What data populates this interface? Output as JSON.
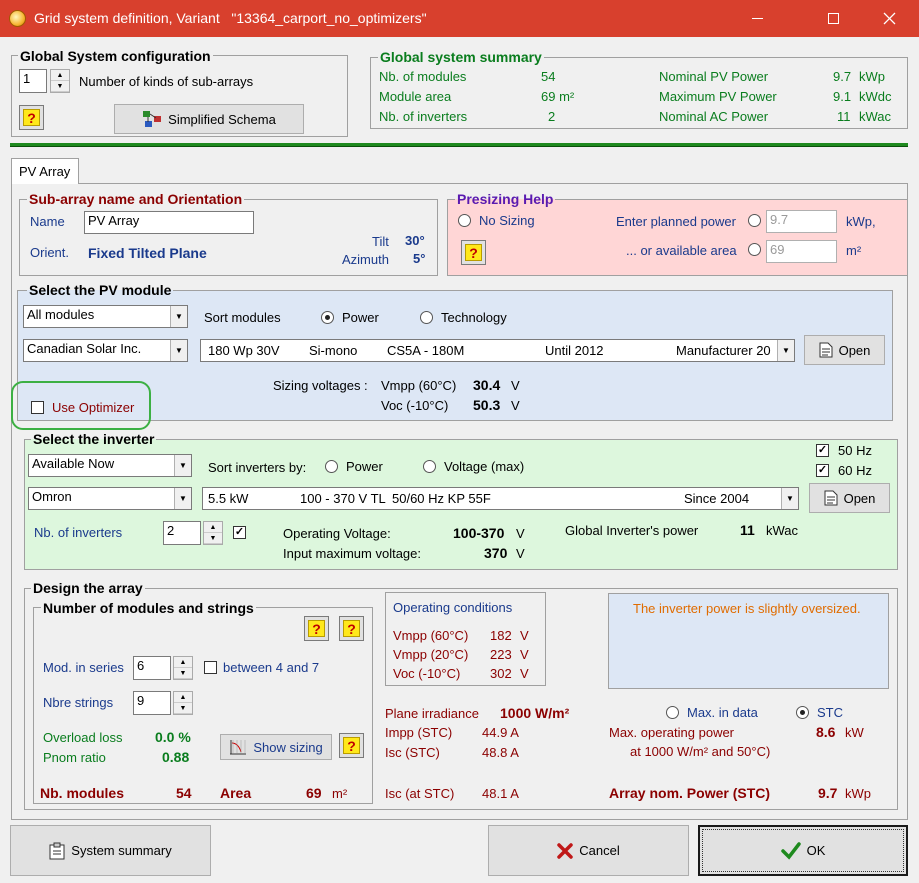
{
  "window": {
    "title": "Grid system definition, Variant   \"13364_carport_no_optimizers\""
  },
  "global_config": {
    "title": "Global System configuration",
    "kinds_value": "1",
    "kinds_label": "Number of kinds of sub-arrays",
    "help_label": "?",
    "schema_button": "Simplified Schema"
  },
  "summary": {
    "title": "Global system summary",
    "nb_modules_label": "Nb. of modules",
    "nb_modules": "54",
    "module_area_label": "Module area",
    "module_area": "69 m²",
    "nb_inverters_label": "Nb. of inverters",
    "nb_inverters": "2",
    "nom_pv_label": "Nominal PV Power",
    "nom_pv_value": "9.7",
    "nom_pv_unit": "kWp",
    "max_pv_label": "Maximum PV Power",
    "max_pv_value": "9.1",
    "max_pv_unit": "kWdc",
    "nom_ac_label": "Nominal AC Power",
    "nom_ac_value": "11",
    "nom_ac_unit": "kWac"
  },
  "tab": {
    "label": "PV Array"
  },
  "subarray": {
    "title": "Sub-array name and Orientation",
    "name_label": "Name",
    "name_value": "PV Array",
    "orient_label": "Orient.",
    "orient_value": "Fixed Tilted Plane",
    "tilt_label": "Tilt",
    "tilt_value": "30°",
    "azimuth_label": "Azimuth",
    "azimuth_value": "5°"
  },
  "presizing": {
    "title": "Presizing Help",
    "no_sizing": "No Sizing",
    "planned_label": "Enter planned power",
    "planned_value": "9.7",
    "planned_unit": "kWp,",
    "area_label": "... or available area",
    "area_value": "69",
    "area_unit": "m²",
    "help_label": "?"
  },
  "module": {
    "title": "Select the PV module",
    "filter": "All modules",
    "sort_label": "Sort modules",
    "sort_power": "Power",
    "sort_tech": "Technology",
    "manufacturer": "Canadian Solar Inc.",
    "model_power": "180 Wp 30V",
    "model_tech": "Si-mono",
    "model_name": "CS5A - 180M",
    "model_until": "Until 2012",
    "model_source": "Manufacturer 20",
    "open_button": "Open",
    "optimizer_label": "Use Optimizer",
    "sizing_label": "Sizing voltages :",
    "vmpp_label": "Vmpp (60°C)",
    "vmpp_value": "30.4",
    "vmpp_unit": "V",
    "voc_label": "Voc  (-10°C)",
    "voc_value": "50.3",
    "voc_unit": "V"
  },
  "inverter": {
    "title": "Select the inverter",
    "hz50": "50 Hz",
    "hz60": "60 Hz",
    "filter": "Available Now",
    "sort_label": "Sort inverters by:",
    "sort_power": "Power",
    "sort_voltage": "Voltage (max)",
    "manufacturer": "Omron",
    "model_power": "5.5 kW",
    "model_range": "100 - 370 V  TL",
    "model_freq": "50/60 Hz  KP 55F",
    "model_since": "Since 2004",
    "open_button": "Open",
    "nb_label": "Nb. of inverters",
    "nb_value": "2",
    "op_voltage_label": "Operating Voltage:",
    "op_voltage_value": "100-370",
    "op_voltage_unit": "V",
    "max_voltage_label": "Input maximum voltage:",
    "max_voltage_value": "370",
    "max_voltage_unit": "V",
    "global_power_label": "Global Inverter's power",
    "global_power_value": "11",
    "global_power_unit": "kWac"
  },
  "design": {
    "title": "Design the array",
    "strings_title": "Number of modules and strings",
    "help_label": "?",
    "series_label": "Mod. in series",
    "series_value": "6",
    "between_label": "between 4 and 7",
    "strings_label": "Nbre strings",
    "strings_value": "9",
    "overload_label": "Overload loss",
    "overload_value": "0.0 %",
    "pnom_label": "Pnom ratio",
    "pnom_value": "0.88",
    "show_sizing": "Show sizing",
    "nb_modules_label": "Nb. modules",
    "nb_modules_value": "54",
    "area_label": "Area",
    "area_value": "69",
    "area_unit": "m²",
    "op_cond_title": "Operating conditions",
    "vmpp60_label": "Vmpp (60°C)",
    "vmpp60_value": "182",
    "vmpp20_label": "Vmpp (20°C)",
    "vmpp20_value": "223",
    "voc10_label": "Voc  (-10°C)",
    "voc10_value": "302",
    "v_unit": "V",
    "message": "The inverter power is slightly oversized.",
    "irr_label": "Plane irradiance",
    "irr_value": "1000 W/m²",
    "max_in_data": "Max. in data",
    "stc": "STC",
    "impp_label": "Impp (STC)",
    "impp_value": "44.9 A",
    "isc_label": "Isc  (STC)",
    "isc_value": "48.8 A",
    "max_op_label": "Max. operating power",
    "max_op_value": "8.6",
    "max_op_unit": "kW",
    "max_op_cond": "at 1000 W/m² and 50°C)",
    "isc_at_label": "Isc (at STC)",
    "isc_at_value": "48.1 A",
    "nom_power_label": "Array nom. Power (STC)",
    "nom_power_value": "9.7",
    "nom_power_unit": "kWp"
  },
  "footer": {
    "summary_button": "System summary",
    "cancel_button": "Cancel",
    "ok_button": "OK"
  },
  "colors": {
    "titlebar": "#d8402d",
    "presizing_bg": "#ffd6d6",
    "module_bg": "#dde7f5",
    "inverter_bg": "#ddf7dd",
    "highlight": "#3cb043"
  }
}
